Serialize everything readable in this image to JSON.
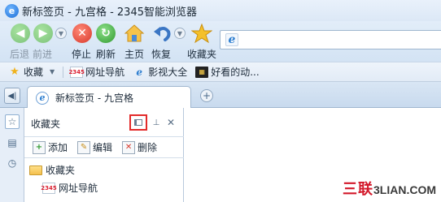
{
  "window": {
    "title": "新标签页 - 九宫格 - 2345智能浏览器",
    "logo_glyph": "e"
  },
  "toolbar": {
    "back_label": "后退",
    "forward_label": "前进",
    "stop_label": "停止",
    "refresh_label": "刷新",
    "home_label": "主页",
    "restore_label": "恢复",
    "favorites_label": "收藏夹"
  },
  "address_bar": {
    "value": "",
    "icon": "ie-e-icon"
  },
  "bookmarks_bar": {
    "favorites_label": "收藏",
    "items": [
      {
        "label": "网址导航",
        "icon": "2345-icon"
      },
      {
        "label": "影视大全",
        "icon": "ie-e-icon"
      },
      {
        "label": "好看的动...",
        "icon": "movie-icon"
      }
    ]
  },
  "tabs": [
    {
      "label": "新标签页 - 九宫格",
      "active": true
    }
  ],
  "favorites_panel": {
    "title": "收藏夹",
    "actions": {
      "add_label": "添加",
      "edit_label": "编辑",
      "delete_label": "删除"
    },
    "tree": [
      {
        "label": "收藏夹",
        "type": "folder"
      },
      {
        "label": "网址导航",
        "type": "site"
      }
    ]
  },
  "watermark": {
    "part1": "三联",
    "part2": "3LIAN.COM"
  },
  "colors": {
    "highlight_box": "#e32a2a",
    "stop_red": "#e04a3a",
    "refresh_green": "#3aa83a",
    "star_yellow": "#f0b21c"
  }
}
